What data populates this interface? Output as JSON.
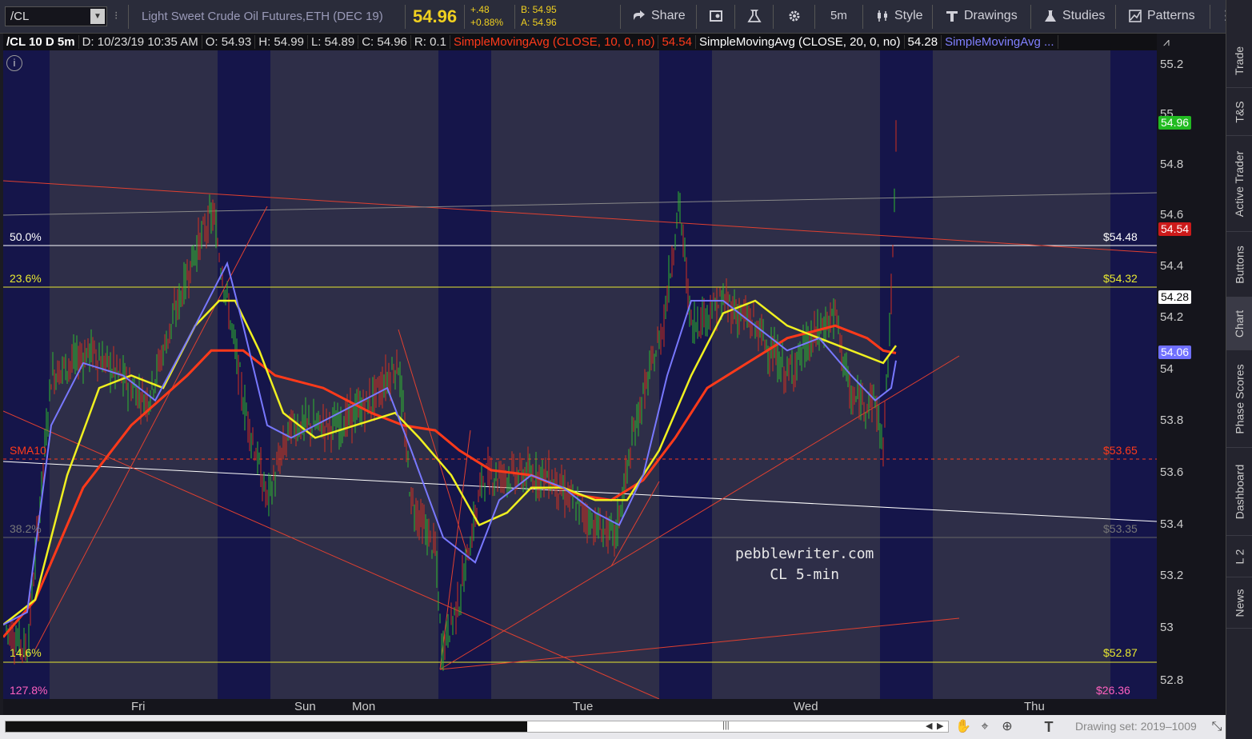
{
  "toolbar": {
    "symbol": "/CL",
    "description": "Light Sweet Crude Oil Futures,ETH (DEC 19)",
    "last_price": "54.96",
    "net_change": "+.48",
    "pct_change": "+0.88%",
    "bid": "B: 54.95",
    "ask": "A: 54.96",
    "share_label": "Share",
    "timeframe_label": "5m",
    "style_label": "Style",
    "drawings_label": "Drawings",
    "studies_label": "Studies",
    "patterns_label": "Patterns"
  },
  "info_bar": {
    "symbol_period": "/CL 10 D 5m",
    "date": "D: 10/23/19 10:35 AM",
    "open": "O: 54.93",
    "high": "H: 54.99",
    "low": "L: 54.89",
    "close": "C: 54.96",
    "range": "R: 0.1",
    "sma10_label": "SimpleMovingAvg (CLOSE, 10, 0, no)",
    "sma10_value": "54.54",
    "sma20_label": "SimpleMovingAvg (CLOSE, 20, 0, no)",
    "sma20_value": "54.28",
    "sma_more_label": "SimpleMovingAvg ..."
  },
  "price_axis": {
    "ticks": [
      "55.2",
      "55",
      "54.8",
      "54.6",
      "54.4",
      "54.2",
      "54",
      "53.8",
      "53.6",
      "53.4",
      "53.2",
      "53",
      "52.8"
    ],
    "badges": {
      "last": "54.96",
      "sma10": "54.54",
      "sma20": "54.28",
      "sma_blue": "54.06"
    }
  },
  "fib_levels": [
    {
      "pct": "50.0%",
      "price": "$54.48"
    },
    {
      "pct": "23.6%",
      "price": "$54.32"
    },
    {
      "pct": "38.2%",
      "price": "$53.35"
    },
    {
      "pct": "14.6%",
      "price": "$52.87"
    },
    {
      "pct": "127.8%",
      "price": "$26.36"
    }
  ],
  "sma_marker": {
    "label": "SMA10",
    "price": "$53.65"
  },
  "time_axis": {
    "labels": [
      "Fri",
      "Sun",
      "Mon",
      "Tue",
      "Wed",
      "Thu"
    ]
  },
  "watermark": {
    "line1": "pebblewriter.com",
    "line2": "CL 5-min"
  },
  "sidebar": {
    "tabs": [
      "Trade",
      "T&S",
      "Active Trader",
      "Buttons",
      "Chart",
      "Phase Scores",
      "Dashboard",
      "L 2",
      "News"
    ]
  },
  "status": {
    "drawing_set": "Drawing set: 2019–1009"
  },
  "colors": {
    "background": "#2e2e48",
    "session_dark": "#15154a",
    "candle_up": "#2fb82f",
    "candle_down": "#d03020",
    "sma10": "#ff3a1a",
    "sma20": "#f0f020",
    "sma_blue": "#7878ff",
    "fib_yellow": "#e8e830",
    "trend_red": "#e04030"
  },
  "chart_data": {
    "type": "line",
    "title": "/CL 10 D 5m",
    "xlabel": "",
    "ylabel": "",
    "ylim": [
      52.75,
      55.25
    ],
    "x": [
      "Thu",
      "Fri",
      "Fri",
      "Fri",
      "Sat",
      "Sun",
      "Mon",
      "Mon",
      "Mon",
      "Tue",
      "Tue",
      "Tue",
      "Wed",
      "Wed",
      "Wed",
      "Wed"
    ],
    "series": [
      {
        "name": "SimpleMovingAvg (CLOSE, 10, 0, no)",
        "values": [
          52.95,
          53.6,
          53.95,
          54.15,
          53.95,
          53.78,
          53.7,
          53.55,
          53.5,
          53.45,
          53.6,
          53.95,
          54.15,
          54.2,
          54.05,
          54.09
        ]
      },
      {
        "name": "SimpleMovingAvg (CLOSE, 20, 0, no)",
        "values": [
          53.0,
          53.85,
          54.0,
          54.3,
          53.8,
          53.8,
          53.72,
          53.4,
          53.6,
          53.45,
          53.7,
          54.25,
          54.28,
          54.1,
          54.05,
          54.12
        ]
      }
    ]
  }
}
